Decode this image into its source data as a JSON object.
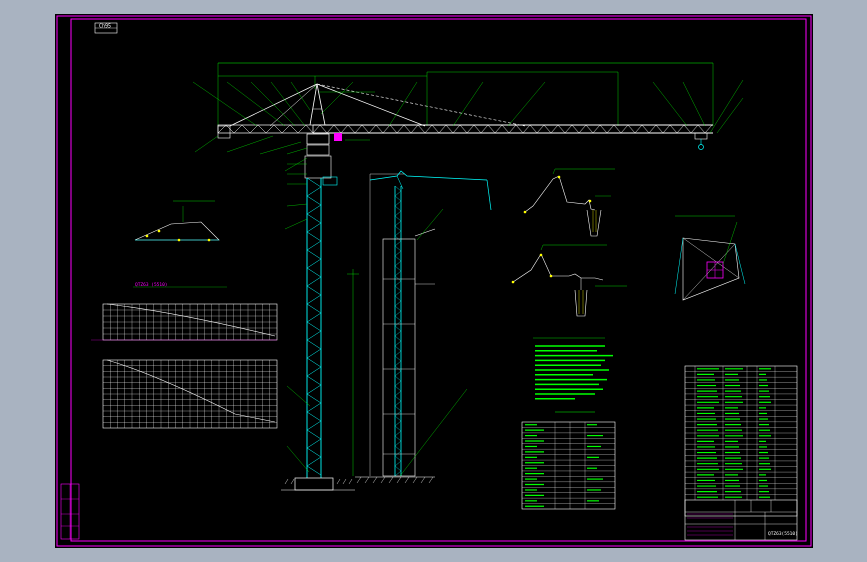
{
  "drawing": {
    "corner_code": "Ch95",
    "chart_title": "QTZ63 (5510)",
    "title_block_label": "QTZ63(5510)",
    "colors": {
      "background": "#000000",
      "border": "#ff00ff",
      "tower": "#00ffff",
      "jib": "#ffffff",
      "dimension": "#00ff00",
      "text": "#00ff00",
      "hoist": "#00ffff"
    }
  }
}
